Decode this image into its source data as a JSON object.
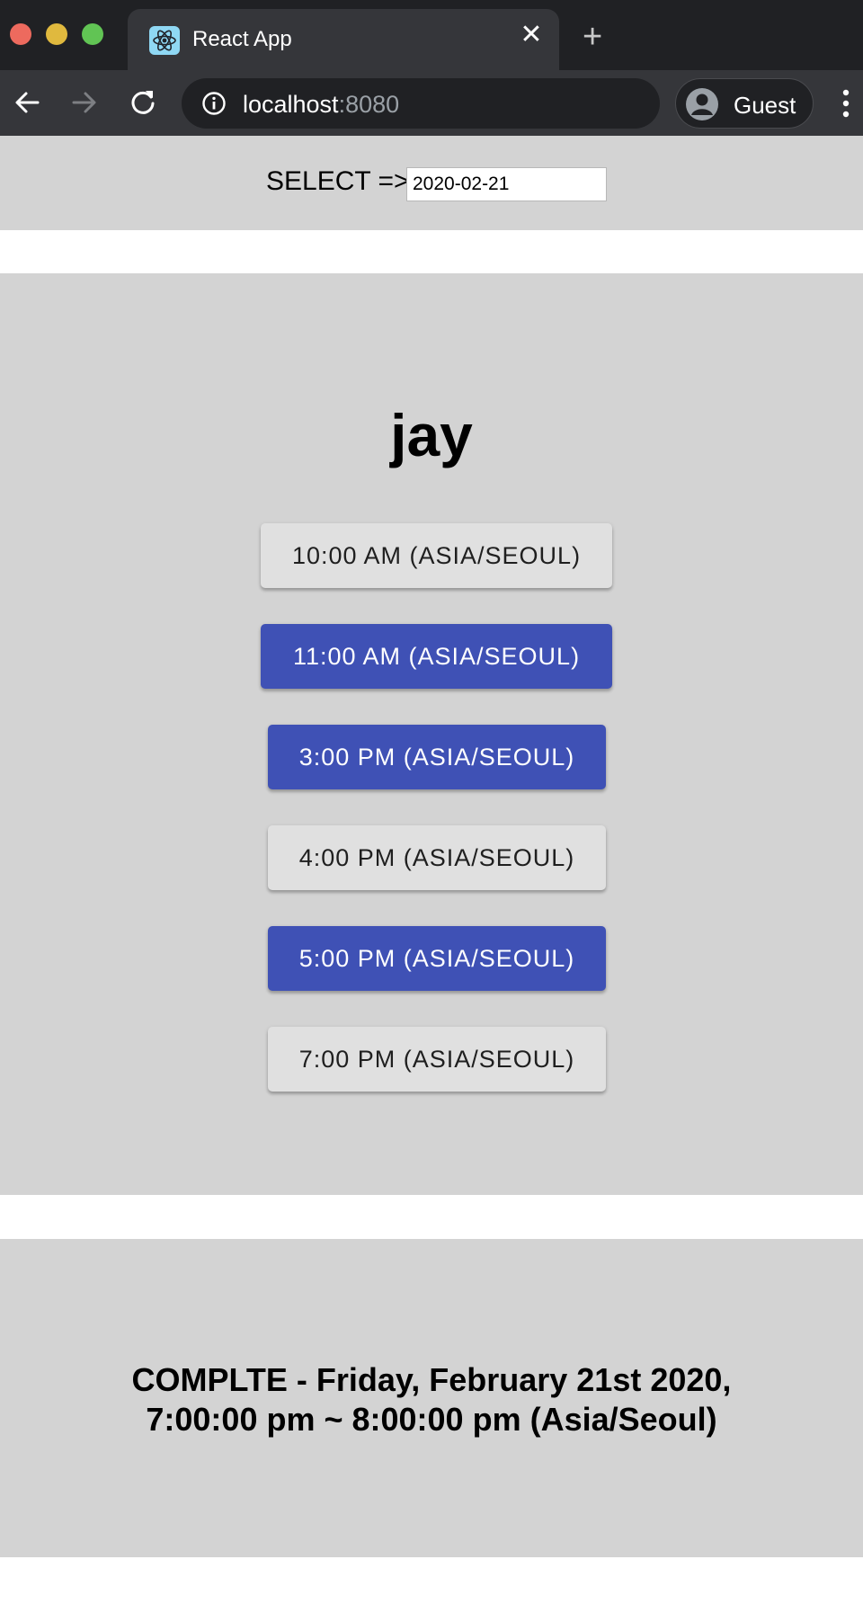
{
  "browser": {
    "tab": {
      "title": "React App",
      "favicon": "react-logo-icon"
    },
    "toolbar": {
      "url_host": "localhost",
      "url_port": ":8080",
      "profile_label": "Guest"
    }
  },
  "select": {
    "label": "SELECT =>",
    "date_value": "2020-02-21"
  },
  "schedule": {
    "name": "jay",
    "slots": [
      {
        "label": "10:00 AM (ASIA/SEOUL)",
        "selected": false
      },
      {
        "label": "11:00 AM (ASIA/SEOUL)",
        "selected": true
      },
      {
        "label": "3:00 PM (ASIA/SEOUL)",
        "selected": true
      },
      {
        "label": "4:00 PM (ASIA/SEOUL)",
        "selected": false
      },
      {
        "label": "5:00 PM (ASIA/SEOUL)",
        "selected": true
      },
      {
        "label": "7:00 PM (ASIA/SEOUL)",
        "selected": false
      }
    ]
  },
  "complete": {
    "line1": "COMPLTE - Friday, February 21st 2020,",
    "line2": "7:00:00 pm ~ 8:00:00 pm (Asia/Seoul)"
  },
  "colors": {
    "selected_slot": "#3f51b5",
    "unselected_slot": "#e0e0e0",
    "panel_background": "#d3d3d3"
  }
}
